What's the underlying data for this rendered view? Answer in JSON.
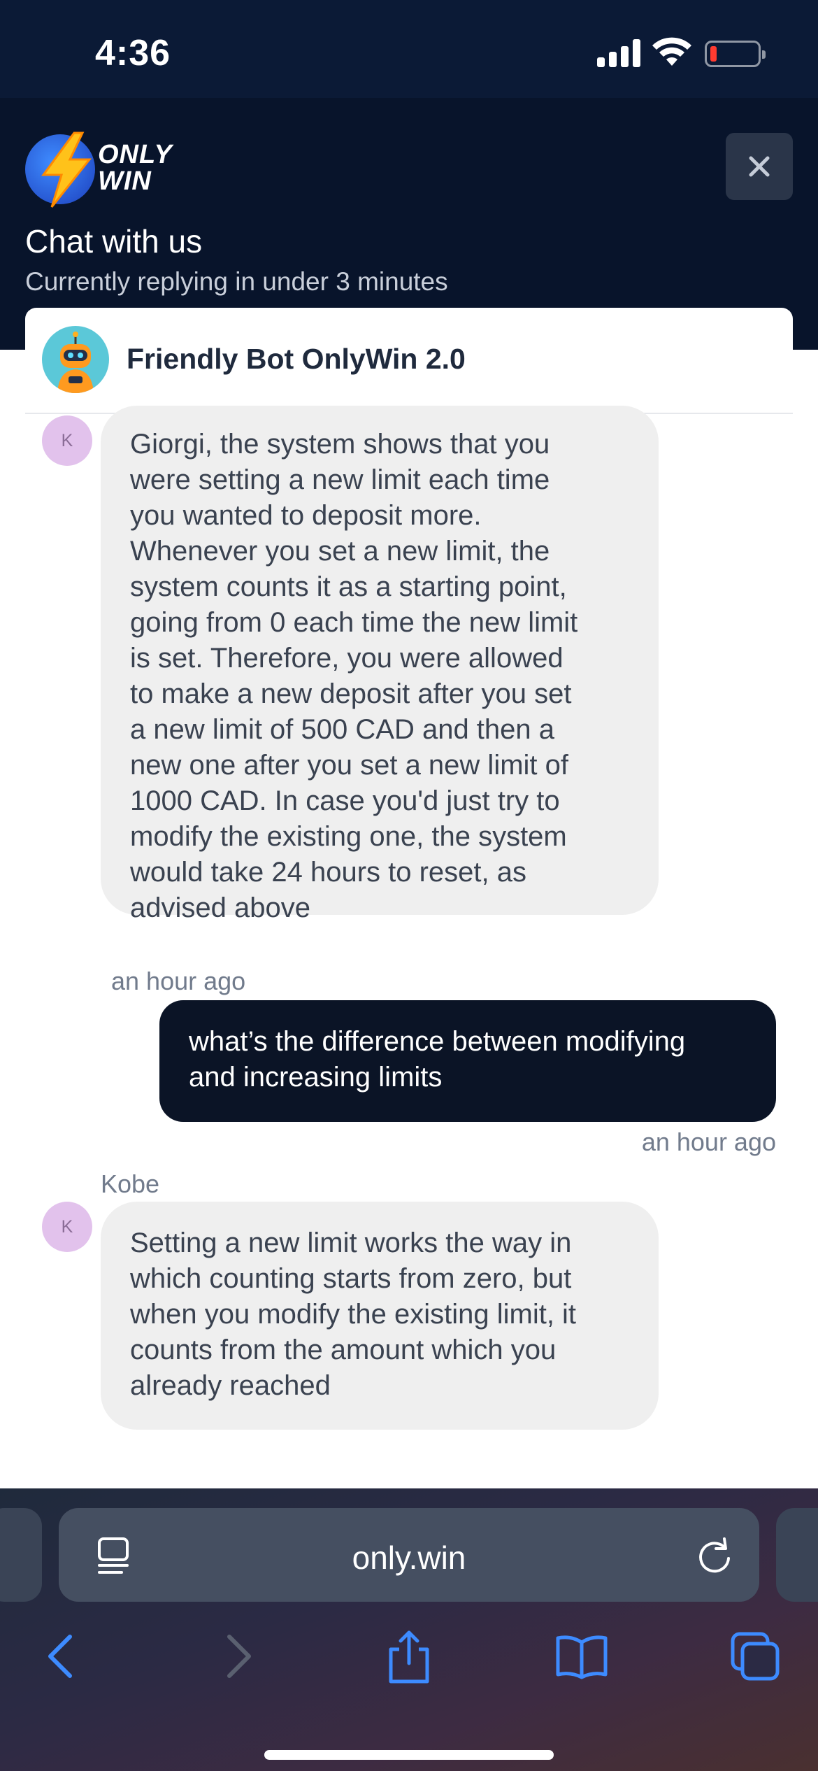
{
  "status_bar": {
    "time": "4:36"
  },
  "header": {
    "logo_line1": "ONLY",
    "logo_line2": "WIN",
    "title": "Chat with us",
    "subtitle": "Currently replying in under 3 minutes"
  },
  "chat": {
    "bot_name": "Friendly Bot OnlyWin 2.0",
    "messages": [
      {
        "avatar_initial": "K",
        "lines": [
          "Giorgi, the system shows that you",
          "were setting a new limit each time",
          "you wanted to deposit more.",
          "Whenever you set a new limit, the",
          "system counts it as a starting point,",
          "going from 0 each time the new limit",
          "is set. Therefore, you were allowed",
          "to make a new deposit after you set",
          "a new limit of 500 CAD and then a",
          "new one after you set a new limit of",
          "1000 CAD. In case you'd just try to",
          "modify the existing one, the system",
          "would take 24 hours to reset, as",
          "advised above"
        ],
        "time": "an hour ago"
      },
      {
        "lines": [
          "what’s the difference between modifying",
          "and increasing limits"
        ],
        "time": "an hour ago"
      },
      {
        "sender": "Kobe",
        "avatar_initial": "K",
        "lines": [
          "Setting a new limit works the way in",
          "which counting starts from zero, but",
          "when you modify the existing limit, it",
          "counts from the amount which you",
          "already reached"
        ]
      }
    ]
  },
  "browser": {
    "url": "only.win"
  },
  "colors": {
    "header_bg": "#08142b",
    "outgoing_bubble": "#0b1426",
    "incoming_bubble": "#efefef",
    "avatar_bg": "#e2c2ec",
    "safari_blue": "#3d8bff"
  }
}
